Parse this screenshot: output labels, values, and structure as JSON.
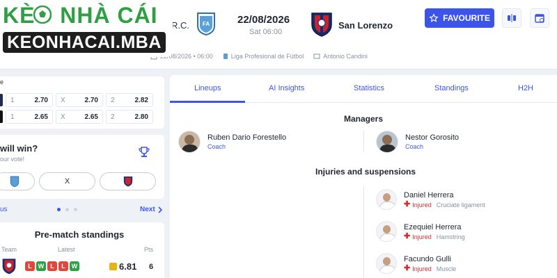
{
  "header": {
    "home_short": "R.C.",
    "date": "22/08/2026",
    "time": "Sat 06:00",
    "away_team": "San Lorenzo",
    "favourite_label": "FAVOURITE",
    "meta": {
      "datetime": "22/08/2026 • 06:00",
      "league": "Liga Profesional de Fútbol",
      "referee": "Antonio Candini"
    }
  },
  "logo": {
    "top": "KÈO NHÀ CÁI",
    "bottom": "KEONHACAI.MBA"
  },
  "odds": {
    "heading": "e",
    "rows": [
      {
        "home_key": "1",
        "home": "2.70",
        "draw_key": "X",
        "draw": "2.70",
        "away_key": "2",
        "away": "2.82"
      },
      {
        "home_key": "1",
        "home": "2.65",
        "draw_key": "X",
        "draw": "2.65",
        "away_key": "2",
        "away": "2.80"
      }
    ]
  },
  "vote": {
    "title": "will win?",
    "subtitle": "our vote!",
    "draw_label": "X"
  },
  "pager": {
    "prev": "us",
    "next": "Next"
  },
  "standings": {
    "title": "Pre-match standings",
    "col_team": "Team",
    "col_latest": "Latest",
    "col_pts": "Pts",
    "form": [
      "L",
      "W",
      "L",
      "L",
      "W"
    ],
    "rating": "6.81",
    "pts": "6",
    "colors": {
      "W": "#2ea043",
      "L": "#e0463a"
    }
  },
  "tabs": [
    "Lineups",
    "AI Insights",
    "Statistics",
    "Standings",
    "H2H"
  ],
  "managers": {
    "title": "Managers",
    "home": {
      "name": "Ruben Dario Forestello",
      "role": "Coach"
    },
    "away": {
      "name": "Nestor Gorosito",
      "role": "Coach"
    }
  },
  "injuries": {
    "title": "Injuries and suspensions",
    "players": [
      {
        "name": "Daniel Herrera",
        "status": "Injured",
        "reason": "Cruciate ligament"
      },
      {
        "name": "Ezequiel Herrera",
        "status": "Injured",
        "reason": "Hamstring"
      },
      {
        "name": "Facundo Gulli",
        "status": "Injured",
        "reason": "Muscle"
      }
    ]
  },
  "colors": {
    "accent": "#3d55e6",
    "logo_green": "#2ea043",
    "injured": "#d42b2b"
  }
}
